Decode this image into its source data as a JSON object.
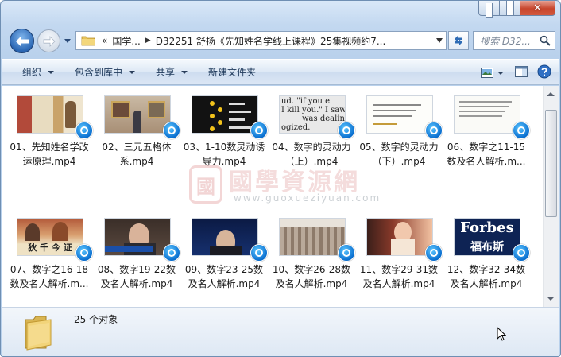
{
  "breadcrumb": {
    "lead": "«",
    "parts": [
      "国学...",
      "D32251 舒扬《先知姓名学线上课程》25集视频约7..."
    ]
  },
  "search": {
    "placeholder": "搜索 D32..."
  },
  "toolbar": {
    "organize": "组织",
    "include_library": "包含到库中",
    "share": "共享",
    "new_folder": "新建文件夹"
  },
  "files": [
    {
      "name": "01、先知姓名学改运原理.mp4",
      "thumb": "art-scroll"
    },
    {
      "name": "02、三元五格体系.mp4",
      "thumb": "gallery"
    },
    {
      "name": "03、1-10数灵动诱导力.mp4",
      "thumb": "slide-dark"
    },
    {
      "name": "04、数字的灵动力（上）.mp4",
      "thumb": "text-photo"
    },
    {
      "name": "05、数字的灵动力（下）.mp4",
      "thumb": "slide-light"
    },
    {
      "name": "06、数字之11-15数及名人解析.m...",
      "thumb": "slide-light2"
    },
    {
      "name": "07、数字之16-18数及名人解析.m...",
      "thumb": "painting"
    },
    {
      "name": "08、数字19-22数及名人解析.mp4",
      "thumb": "news-man"
    },
    {
      "name": "09、数字23-25数及名人解析.mp4",
      "thumb": "speaker"
    },
    {
      "name": "10、数字26-28数及名人解析.mp4",
      "thumb": "building"
    },
    {
      "name": "11、数字29-31数及名人解析.mp4",
      "thumb": "singer"
    },
    {
      "name": "12、数字32-34数及名人解析.mp4",
      "thumb": "forbes"
    }
  ],
  "thumb_text": {
    "painting": "狄 千 今 证",
    "forbes_en": "Forbes",
    "forbes_cn": "福布斯",
    "text_photo": [
      "ud.  \"if you e",
      "I kill you.\" I saw",
      "was dealing",
      "ogized."
    ]
  },
  "watermark": {
    "seal": "國",
    "chinese": "國學資源網",
    "url": "www.guoxueziyuan.com"
  },
  "status": {
    "count": "25 个对象"
  },
  "colors": {
    "accent": "#1e395b",
    "badge": "#0a6fd0",
    "close": "#c7452c"
  }
}
